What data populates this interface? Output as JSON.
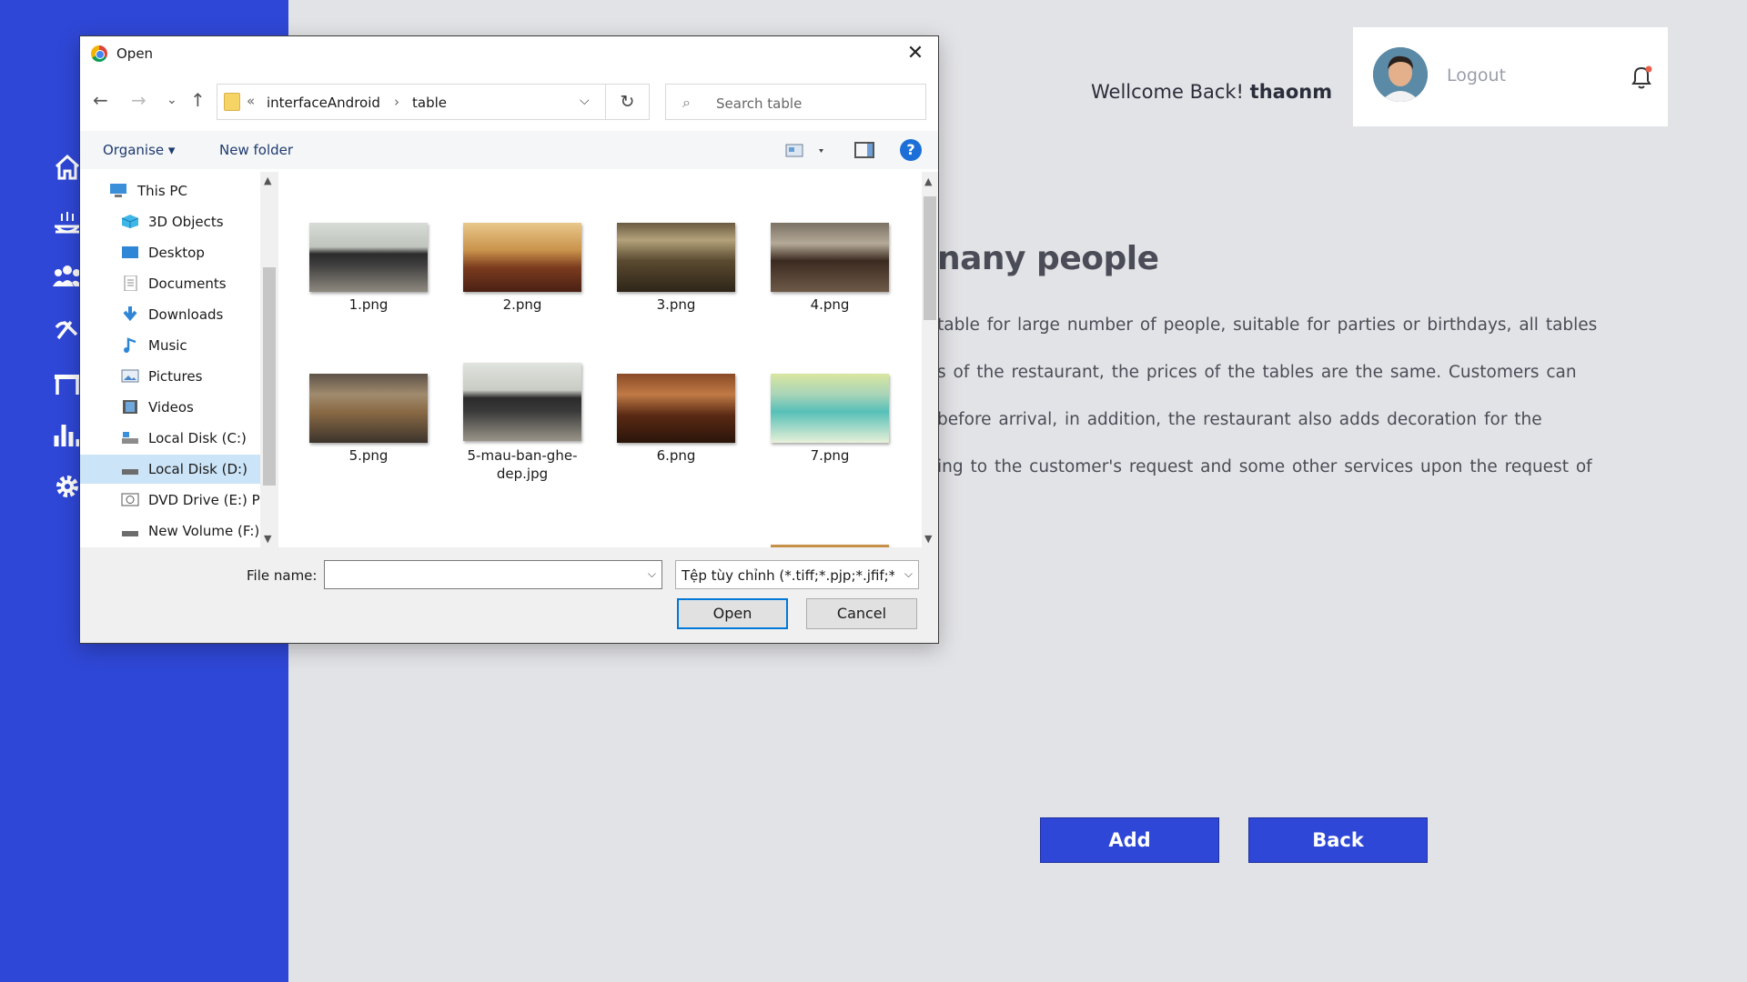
{
  "app": {
    "welcome_prefix": "Wellcome Back!",
    "username": "thaonm",
    "logout_label": "Logout",
    "heading_partial": "nany people",
    "paragraph_lines": [
      "table for large number of people, suitable for parties or birthdays, all tables",
      "s  of the restaurant, the prices of the tables are the same. Customers can",
      "before  arrival, in addition, the  restaurant  also adds  decoration  for the",
      "ing  to  the  customer's  request and some  other services upon the request of"
    ],
    "add_label": "Add",
    "back_label": "Back",
    "sidebar_icons": [
      "home-icon",
      "food-icon",
      "users-icon",
      "staff-icon",
      "table-icon",
      "stats-icon",
      "settings-icon"
    ],
    "colors": {
      "sidebar": "#2f47d6",
      "background": "#e2e3e6",
      "button": "#2f47d6"
    }
  },
  "dialog": {
    "title": "Open",
    "close_glyph": "✕",
    "nav": {
      "back": "←",
      "forward": "→",
      "recent": "⌄",
      "up": "↑"
    },
    "address": {
      "lead": "«",
      "folder": "interfaceAndroid",
      "separator": "›",
      "current": "table",
      "dropdown": "⌵",
      "refresh": "↻"
    },
    "search_placeholder": "Search table",
    "toolbar": {
      "organise": "Organise ▾",
      "new_folder": "New folder",
      "help": "?"
    },
    "tree": [
      {
        "label": "This PC",
        "icon": "pc-icon"
      },
      {
        "label": "3D Objects",
        "icon": "3d-objects-icon"
      },
      {
        "label": "Desktop",
        "icon": "desktop-icon"
      },
      {
        "label": "Documents",
        "icon": "documents-icon"
      },
      {
        "label": "Downloads",
        "icon": "downloads-icon"
      },
      {
        "label": "Music",
        "icon": "music-icon"
      },
      {
        "label": "Pictures",
        "icon": "pictures-icon"
      },
      {
        "label": "Videos",
        "icon": "videos-icon"
      },
      {
        "label": "Local Disk (C:)",
        "icon": "drive-icon"
      },
      {
        "label": "Local Disk (D:)",
        "icon": "drive-icon",
        "selected": true
      },
      {
        "label": "DVD Drive (E:) PF",
        "icon": "dvd-icon"
      },
      {
        "label": "New Volume (F:)",
        "icon": "drive-icon"
      }
    ],
    "files": [
      {
        "name": "1.png"
      },
      {
        "name": "2.png"
      },
      {
        "name": "3.png"
      },
      {
        "name": "4.png"
      },
      {
        "name": "5.png"
      },
      {
        "name": "5-mau-ban-ghe-dep.jpg",
        "name_lines": [
          "5-mau-ban-ghe-",
          "dep.jpg"
        ]
      },
      {
        "name": "6.png"
      },
      {
        "name": "7.png"
      }
    ],
    "filename_label": "File name:",
    "filename_value": "",
    "filter_value": "Tệp tùy chỉnh (*.tiff;*.pjp;*.jfif;*",
    "open_label": "Open",
    "cancel_label": "Cancel"
  }
}
